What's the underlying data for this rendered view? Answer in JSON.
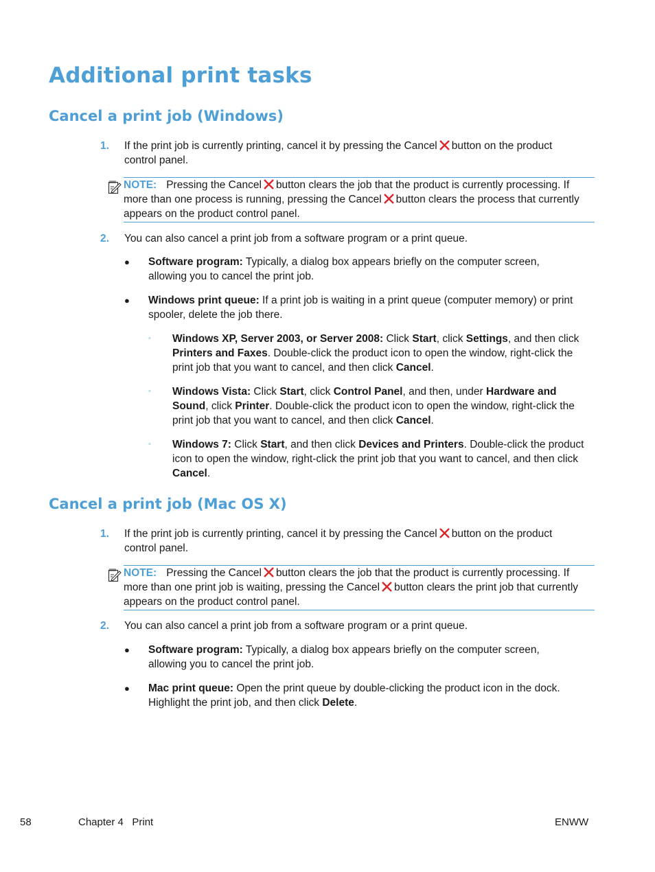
{
  "page_title": "Additional print tasks",
  "sections": [
    {
      "heading": "Cancel a print job (Windows)",
      "step1": {
        "number": "1.",
        "text_before": "If the print job is currently printing, cancel it by pressing the Cancel",
        "icon": "cancel-x-icon",
        "text_after": "button on the product control panel."
      },
      "note": {
        "label": "NOTE:",
        "part1": "Pressing the Cancel",
        "part2": "button clears the job that the product is currently processing. If more than one process is running, pressing the Cancel",
        "part3": "button clears the process that currently appears on the product control panel."
      },
      "step2": {
        "number": "2.",
        "text": "You can also cancel a print job from a software program or a print queue."
      },
      "bullets": [
        {
          "bold": "Software program:",
          "text": " Typically, a dialog box appears briefly on the computer screen, allowing you to cancel the print job."
        },
        {
          "bold": "Windows print queue:",
          "text": " If a print job is waiting in a print queue (computer memory) or print spooler, delete the job there."
        }
      ],
      "sub_bullets": [
        {
          "segments": [
            {
              "b": "Windows XP, Server 2003, or Server 2008:"
            },
            {
              "t": " Click "
            },
            {
              "b": "Start"
            },
            {
              "t": ", click "
            },
            {
              "b": "Settings"
            },
            {
              "t": ", and then click "
            },
            {
              "b": "Printers and Faxes"
            },
            {
              "t": ". Double-click the product icon to open the window, right-click the print job that you want to cancel, and then click "
            },
            {
              "b": "Cancel"
            },
            {
              "t": "."
            }
          ]
        },
        {
          "segments": [
            {
              "b": "Windows Vista:"
            },
            {
              "t": " Click "
            },
            {
              "b": "Start"
            },
            {
              "t": ", click "
            },
            {
              "b": "Control Panel"
            },
            {
              "t": ", and then, under "
            },
            {
              "b": "Hardware and Sound"
            },
            {
              "t": ", click "
            },
            {
              "b": "Printer"
            },
            {
              "t": ". Double-click the product icon to open the window, right-click the print job that you want to cancel, and then click "
            },
            {
              "b": "Cancel"
            },
            {
              "t": "."
            }
          ]
        },
        {
          "segments": [
            {
              "b": "Windows 7:"
            },
            {
              "t": " Click "
            },
            {
              "b": "Start"
            },
            {
              "t": ", and then click "
            },
            {
              "b": "Devices and Printers"
            },
            {
              "t": ". Double-click the product icon to open the window, right-click the print job that you want to cancel, and then click "
            },
            {
              "b": "Cancel"
            },
            {
              "t": "."
            }
          ]
        }
      ]
    },
    {
      "heading": "Cancel a print job (Mac OS X)",
      "step1": {
        "number": "1.",
        "text_before": "If the print job is currently printing, cancel it by pressing the Cancel",
        "icon": "cancel-x-icon",
        "text_after": "button on the product control panel."
      },
      "note": {
        "label": "NOTE:",
        "part1": "Pressing the Cancel",
        "part2": "button clears the job that the product is currently processing. If more than one print job is waiting, pressing the Cancel",
        "part3": "button clears the print job that currently appears on the product control panel."
      },
      "step2": {
        "number": "2.",
        "text": "You can also cancel a print job from a software program or a print queue."
      },
      "bullets": [
        {
          "bold": "Software program:",
          "text": " Typically, a dialog box appears briefly on the computer screen, allowing you to cancel the print job."
        },
        {
          "bold": "Mac print queue:",
          "text": " Open the print queue by double-clicking the product icon in the dock. Highlight the print job, and then click ",
          "bold2": "Delete",
          "text2": "."
        }
      ]
    }
  ],
  "footer": {
    "page_number": "58",
    "chapter": "Chapter 4   Print",
    "right": "ENWW"
  },
  "colors": {
    "accent": "#4d9fd6",
    "cancel_icon": "#d9262b"
  }
}
